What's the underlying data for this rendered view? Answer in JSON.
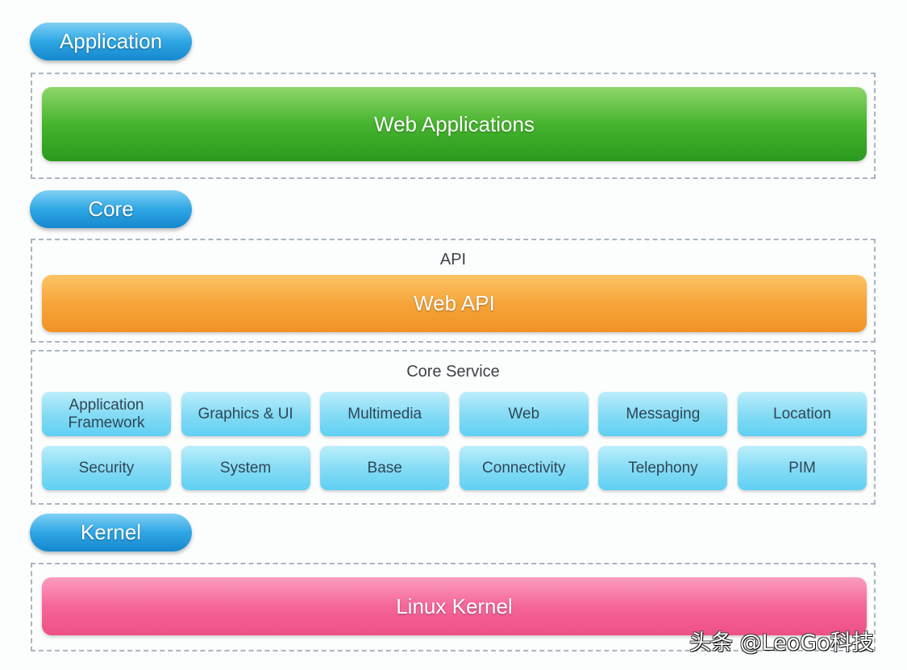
{
  "layers": {
    "application": "Application",
    "core": "Core",
    "kernel": "Kernel"
  },
  "application": {
    "bar": "Web Applications"
  },
  "api": {
    "title": "API",
    "bar": "Web API"
  },
  "core_service": {
    "title": "Core Service",
    "items": [
      "Application\nFramework",
      "Graphics & UI",
      "Multimedia",
      "Web",
      "Messaging",
      "Location",
      "Security",
      "System",
      "Base",
      "Connectivity",
      "Telephony",
      "PIM"
    ]
  },
  "kernel": {
    "bar": "Linux Kernel"
  },
  "watermark": "头条 @LeoGo科技",
  "colors": {
    "layer_label": "#2ea6e4",
    "application": "#46b42d",
    "api": "#f6a53a",
    "core_service": "#86dcf5",
    "kernel": "#f5669a"
  }
}
